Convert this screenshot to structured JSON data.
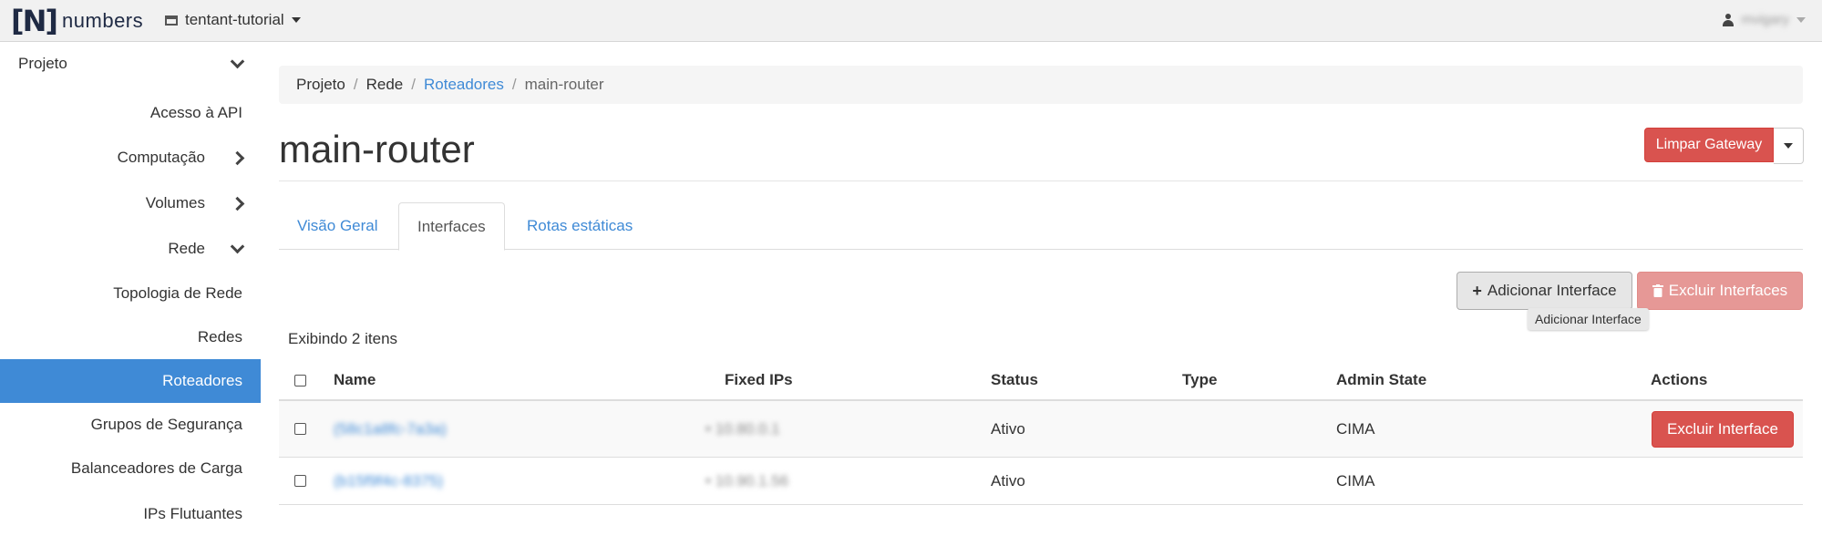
{
  "app": {
    "brand_bracket": "[N]",
    "brand_name": "numbers",
    "project": "tentant-tutorial",
    "user": "mvigary"
  },
  "sidebar": {
    "items": [
      {
        "label": "Projeto",
        "chevron": "down"
      },
      {
        "label": "Acesso à API"
      },
      {
        "label": "Computação",
        "chevron": "right"
      },
      {
        "label": "Volumes",
        "chevron": "right"
      },
      {
        "label": "Rede",
        "chevron": "down"
      },
      {
        "label": "Topologia de Rede"
      },
      {
        "label": "Redes"
      },
      {
        "label": "Roteadores",
        "active": true
      },
      {
        "label": "Grupos de Segurança"
      },
      {
        "label": "Balanceadores de Carga"
      },
      {
        "label": "IPs Flutuantes"
      }
    ]
  },
  "breadcrumb": [
    "Projeto",
    "Rede",
    "Roteadores",
    "main-router"
  ],
  "page": {
    "title": "main-router",
    "clear_gateway": "Limpar Gateway"
  },
  "tabs": [
    "Visão Geral",
    "Interfaces",
    "Rotas estáticas"
  ],
  "actions": {
    "add_interface": "Adicionar Interface",
    "delete_interfaces": "Excluir Interfaces",
    "tooltip": "Adicionar Interface"
  },
  "table": {
    "count": "Exibindo 2 itens",
    "columns": [
      "Name",
      "Fixed IPs",
      "Status",
      "Type",
      "Admin State",
      "Actions"
    ],
    "rows": [
      {
        "name": "(58c1a8fc-7a3a)",
        "ip": "10.80.0.1",
        "status": "Ativo",
        "type": "",
        "admin": "CIMA",
        "action": "Excluir Interface"
      },
      {
        "name": "(b15f9f4c-8375)",
        "ip": "10.90.1.56",
        "status": "Ativo",
        "type": "",
        "admin": "CIMA",
        "action": ""
      }
    ]
  },
  "colors": {
    "accent": "#3f8ad6",
    "danger": "#d9534f"
  }
}
